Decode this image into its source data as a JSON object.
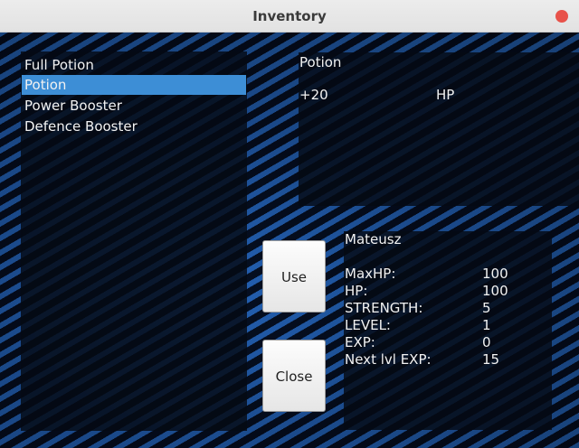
{
  "window": {
    "title": "Inventory"
  },
  "inventory": {
    "items": [
      {
        "label": "Full Potion"
      },
      {
        "label": "Potion"
      },
      {
        "label": "Power Booster"
      },
      {
        "label": "Defence Booster"
      }
    ],
    "selected_index": 1
  },
  "detail": {
    "name": "Potion",
    "effect_value": "+20",
    "effect_stat": "HP"
  },
  "buttons": {
    "use_label": "Use",
    "close_label": "Close"
  },
  "player": {
    "name": "Mateusz",
    "stats": [
      {
        "label": "MaxHP:",
        "value": "100"
      },
      {
        "label": "HP:",
        "value": "100"
      },
      {
        "label": "STRENGTH:",
        "value": "5"
      },
      {
        "label": "LEVEL:",
        "value": "1"
      },
      {
        "label": "EXP:",
        "value": "0"
      },
      {
        "label": "Next lvl EXP:",
        "value": "15"
      }
    ]
  },
  "colors": {
    "selection": "#3d8ed6",
    "close_button": "#e8524a"
  }
}
